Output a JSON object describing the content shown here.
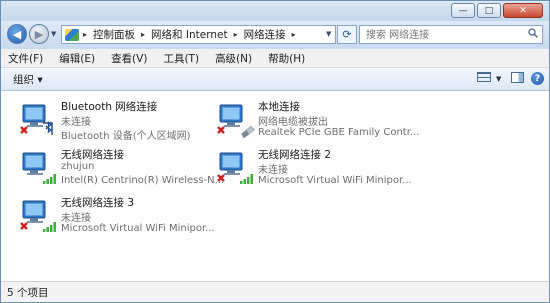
{
  "window": {
    "minimize_label": "—",
    "maximize_label": "□",
    "close_label": "✕"
  },
  "nav": {
    "back_glyph": "◀",
    "forward_glyph": "▶",
    "dropdown_glyph": "▼",
    "refresh_glyph": "⟳"
  },
  "address": {
    "crumbs": [
      "控制面板",
      "网络和 Internet",
      "网络连接"
    ],
    "separator": "▸"
  },
  "search": {
    "placeholder": "搜索 网络连接"
  },
  "menu": {
    "items": [
      "文件(F)",
      "编辑(E)",
      "查看(V)",
      "工具(T)",
      "高级(N)",
      "帮助(H)"
    ]
  },
  "toolbar": {
    "organize_label": "组织 ▾",
    "view_dropdown_glyph": "▼",
    "help_glyph": "?"
  },
  "connections": [
    {
      "name": "Bluetooth 网络连接",
      "status": "未连接",
      "device": "Bluetooth 设备(个人区域网)",
      "kind": "bluetooth",
      "disconnected": true
    },
    {
      "name": "本地连接",
      "status": "网络电缆被拔出",
      "device": "Realtek PCIe GBE Family Contr...",
      "kind": "ethernet",
      "disconnected": true
    },
    {
      "name": "无线网络连接",
      "status": "zhujun",
      "device": "Intel(R) Centrino(R) Wireless-N...",
      "kind": "wifi",
      "disconnected": false
    },
    {
      "name": "无线网络连接 2",
      "status": "未连接",
      "device": "Microsoft Virtual WiFi Minipor...",
      "kind": "wifi",
      "disconnected": true
    },
    {
      "name": "无线网络连接 3",
      "status": "未连接",
      "device": "Microsoft Virtual WiFi Minipor...",
      "kind": "wifi",
      "disconnected": true
    }
  ],
  "status": {
    "text": "5 个项目"
  },
  "colors": {
    "disconnected_x": "#d02020",
    "signal_green": "#3fae3f",
    "link_blue": "#2b5f96"
  }
}
